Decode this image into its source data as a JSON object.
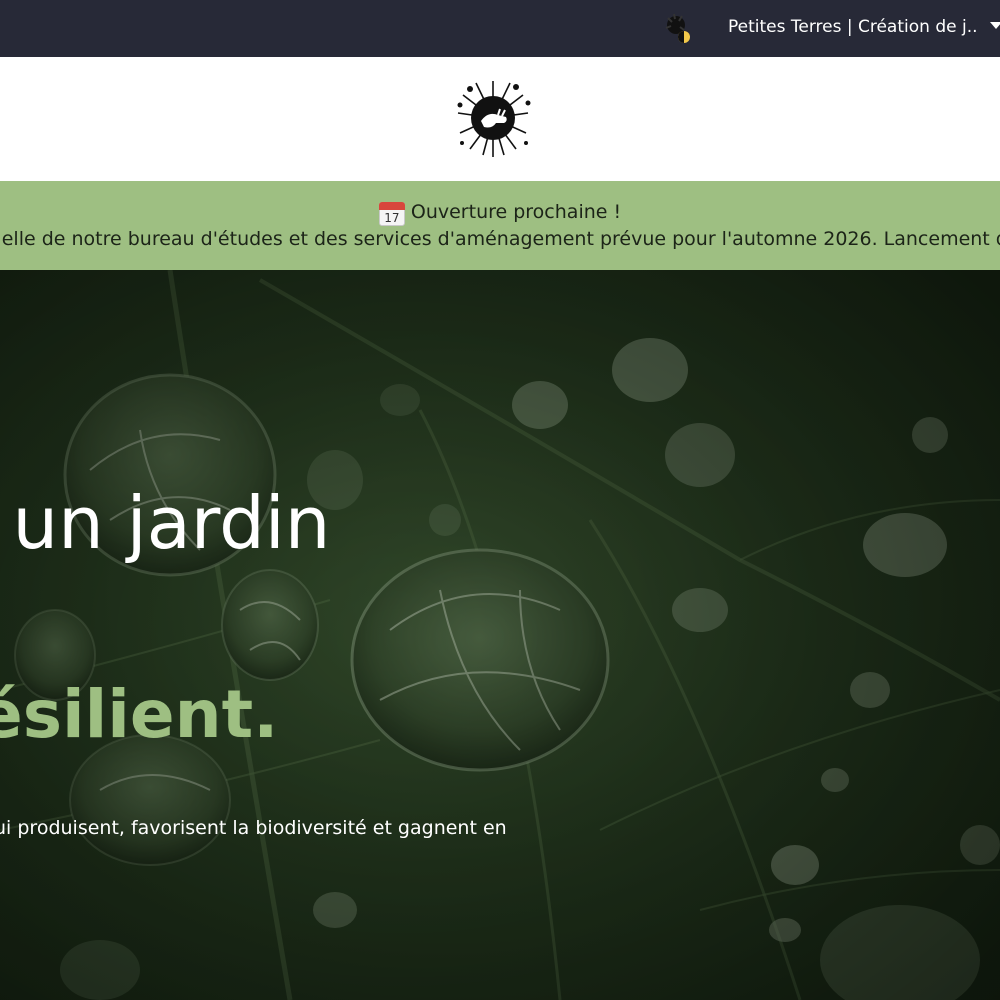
{
  "browser": {
    "tab_title": "Petites Terres | Création de j...",
    "tab_icon": "site-favicon-icon",
    "menu_icon": "chevron-down-icon"
  },
  "header": {
    "logo_icon": "hand-with-plants-logo-icon"
  },
  "banner": {
    "icon": "calendar-icon",
    "calendar_day": "17",
    "title": "Ouverture prochaine !",
    "text": "cielle de notre bureau d'études et des services d'aménagement prévue pour l'automne 2026. Lancement du proj"
  },
  "hero": {
    "line1": "r un jardin",
    "line2": ",",
    "line3": "ésilient.",
    "subtitle": "ui produisent, favorisent la biodiversité et gagnent en"
  },
  "colors": {
    "topbar_bg": "#272937",
    "banner_bg": "#9ebf82",
    "accent_green": "#9ebf82",
    "hero_text": "#ffffff"
  }
}
